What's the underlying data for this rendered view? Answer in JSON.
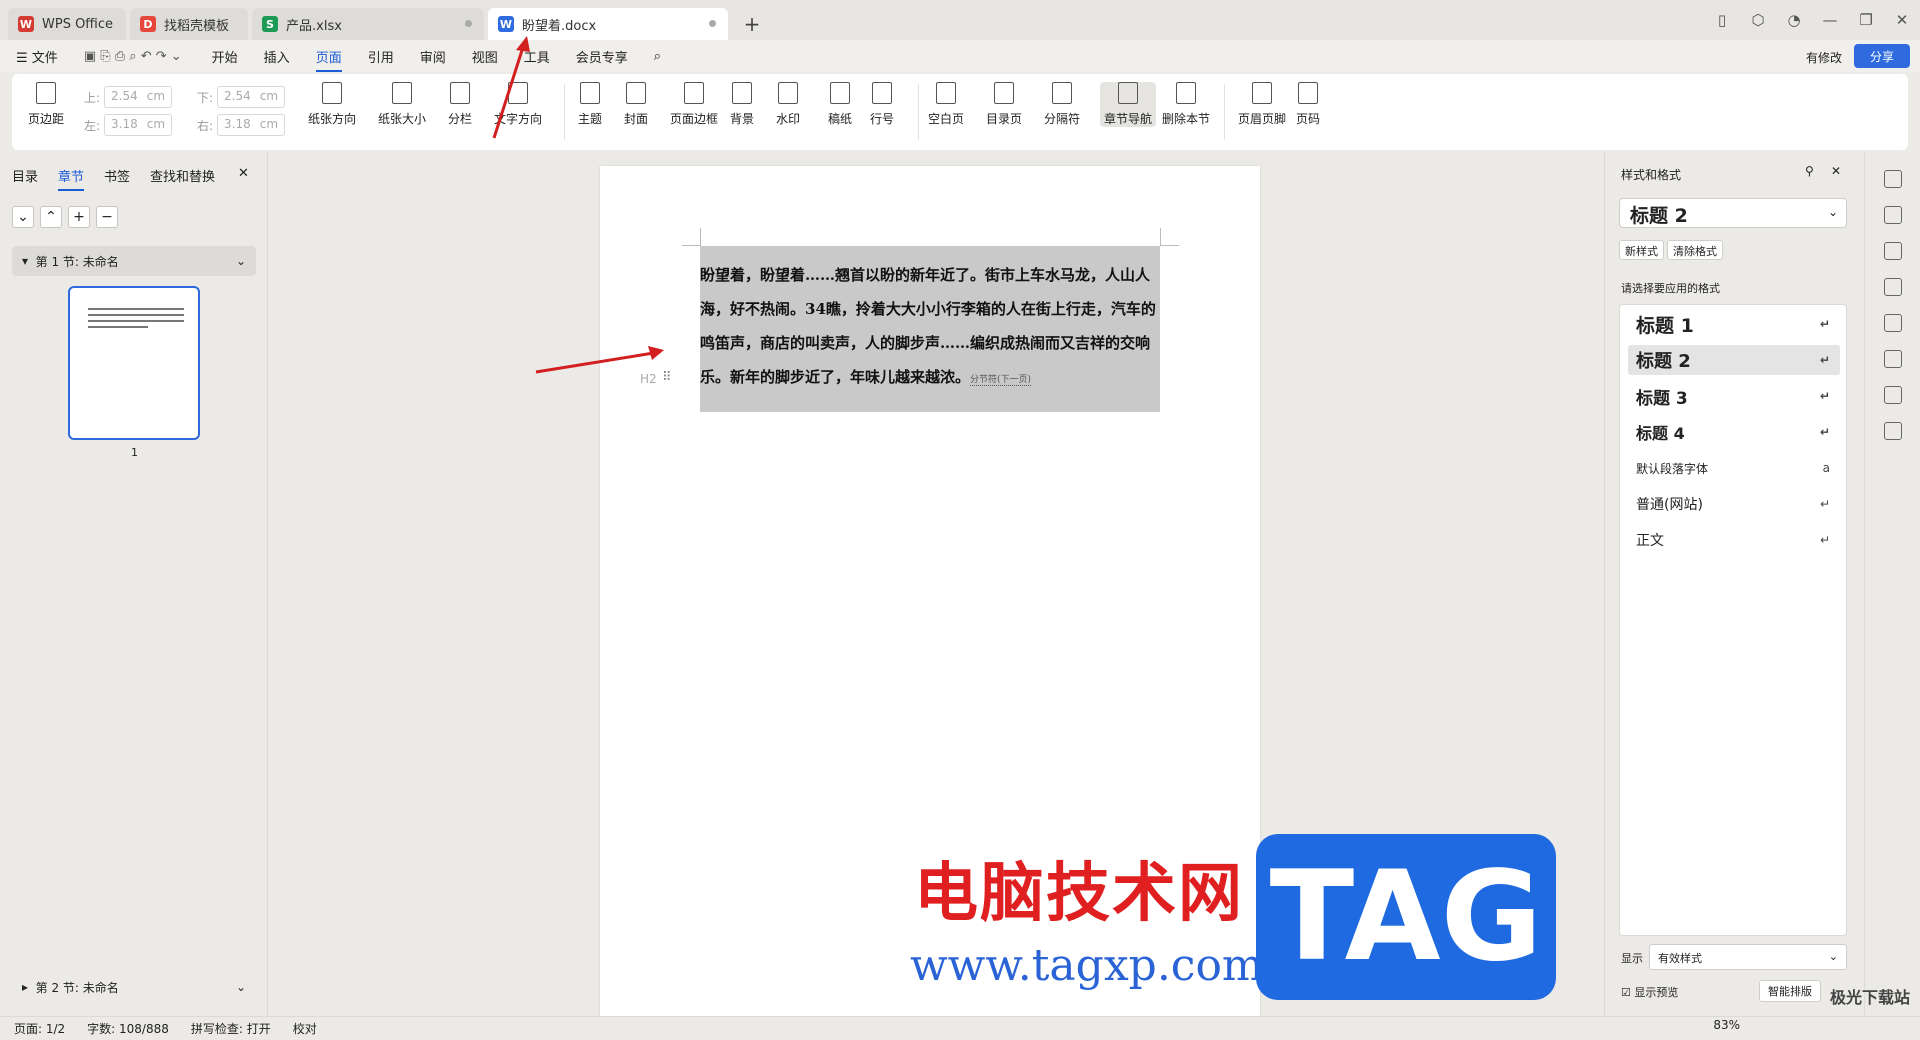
{
  "tabs": [
    {
      "label": "WPS Office",
      "color": "#d43c33"
    },
    {
      "label": "找稻壳模板",
      "color": "#e8483c"
    },
    {
      "label": "产品.xlsx",
      "color": "#1d9a55"
    },
    {
      "label": "盼望着.docx",
      "color": "#2f6bde"
    }
  ],
  "menu": {
    "file": "文件",
    "items": [
      "开始",
      "插入",
      "页面",
      "引用",
      "审阅",
      "视图",
      "工具",
      "会员专享"
    ],
    "active": "页面",
    "modified": "有修改",
    "share": "分享"
  },
  "ribbon": {
    "margins": "页边距",
    "top_label": "上:",
    "bottom_label": "下:",
    "left_label": "左:",
    "right_label": "右:",
    "top": "2.54",
    "bottom": "2.54",
    "left": "3.18",
    "right": "3.18",
    "unit": "cm",
    "buttons": [
      "纸张方向",
      "纸张大小",
      "分栏",
      "文字方向",
      "主题",
      "封面",
      "页面边框",
      "背景",
      "水印",
      "稿纸",
      "行号",
      "空白页",
      "目录页",
      "分隔符",
      "章节导航",
      "删除本节",
      "页眉页脚",
      "页码"
    ]
  },
  "left": {
    "tabs": [
      "目录",
      "章节",
      "书签",
      "查找和替换"
    ],
    "section1": "第 1 节: 未命名",
    "section2": "第 2 节: 未命名",
    "page_num": "1"
  },
  "doc": {
    "text": "盼望着，盼望着……翘首以盼的新年近了。街市上车水马龙，人山人海，好不热闹。34瞧，拎着大大小小行李箱的人在街上行走，汽车的鸣笛声，商店的叫卖声，人的脚步声……编织成热闹而又吉祥的交响乐。新年的脚步近了，年味儿越来越浓。",
    "section_break": "分节符(下一页)",
    "heading_mark": "H2"
  },
  "right": {
    "title": "样式和格式",
    "current": "标题 2",
    "new_style": "新样式",
    "clear": "清除格式",
    "prompt": "请选择要应用的格式",
    "styles": [
      "标题 1",
      "标题 2",
      "标题 3",
      "标题 4",
      "默认段落字体",
      "普通(网站)",
      "正文"
    ],
    "show_label": "显示",
    "show_value": "有效样式",
    "preview": "显示预览",
    "smart": "智能排版"
  },
  "status": {
    "page": "页面: 1/2",
    "words": "字数: 108/888",
    "spell": "拼写检查: 打开",
    "proof": "校对",
    "zoom": "83%"
  },
  "watermark": {
    "cn": "电脑技术网",
    "url": "www.tagxp.com",
    "tag": "TAG",
    "corner": "极光下载站"
  }
}
